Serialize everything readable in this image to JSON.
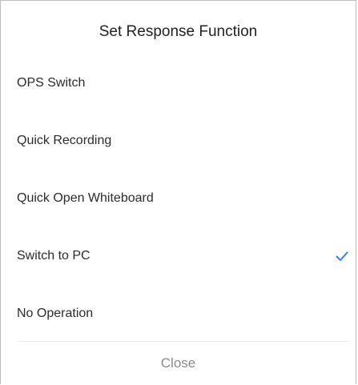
{
  "dialog": {
    "title": "Set Response Function",
    "options": [
      {
        "label": "OPS Switch",
        "selected": false
      },
      {
        "label": "Quick Recording",
        "selected": false
      },
      {
        "label": "Quick Open Whiteboard",
        "selected": false
      },
      {
        "label": "Switch to PC",
        "selected": true
      },
      {
        "label": "No Operation",
        "selected": false
      }
    ],
    "selected_icon": "checkmark-icon",
    "close_label": "Close"
  },
  "colors": {
    "accent": "#2f80ed",
    "title_text": "#222222",
    "option_text": "#2b2b2b",
    "close_text": "#8a8a8a",
    "divider": "#ececec"
  }
}
